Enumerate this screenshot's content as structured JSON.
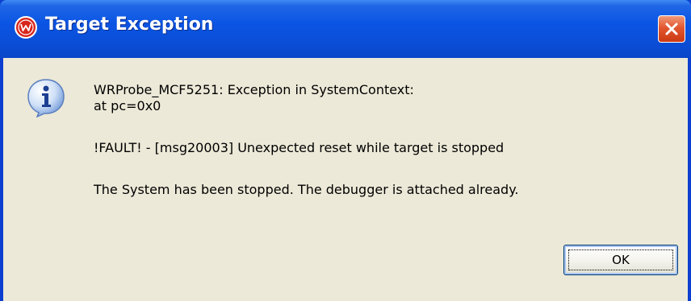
{
  "window": {
    "title": "Target Exception",
    "app_icon": "windriver-logo-icon",
    "close_icon": "close-icon"
  },
  "dialog": {
    "icon": "info-icon",
    "lines": [
      "WRProbe_MCF5251: Exception in  SystemContext:",
      "at pc=0x0",
      "!FAULT! - [msg20003] Unexpected reset while target is stopped",
      "The System has been stopped. The debugger is attached already."
    ],
    "ok_label": "OK"
  },
  "colors": {
    "titlebar": "#0a4fd8",
    "client_bg": "#ece9d8",
    "close_button": "#e2572f"
  }
}
